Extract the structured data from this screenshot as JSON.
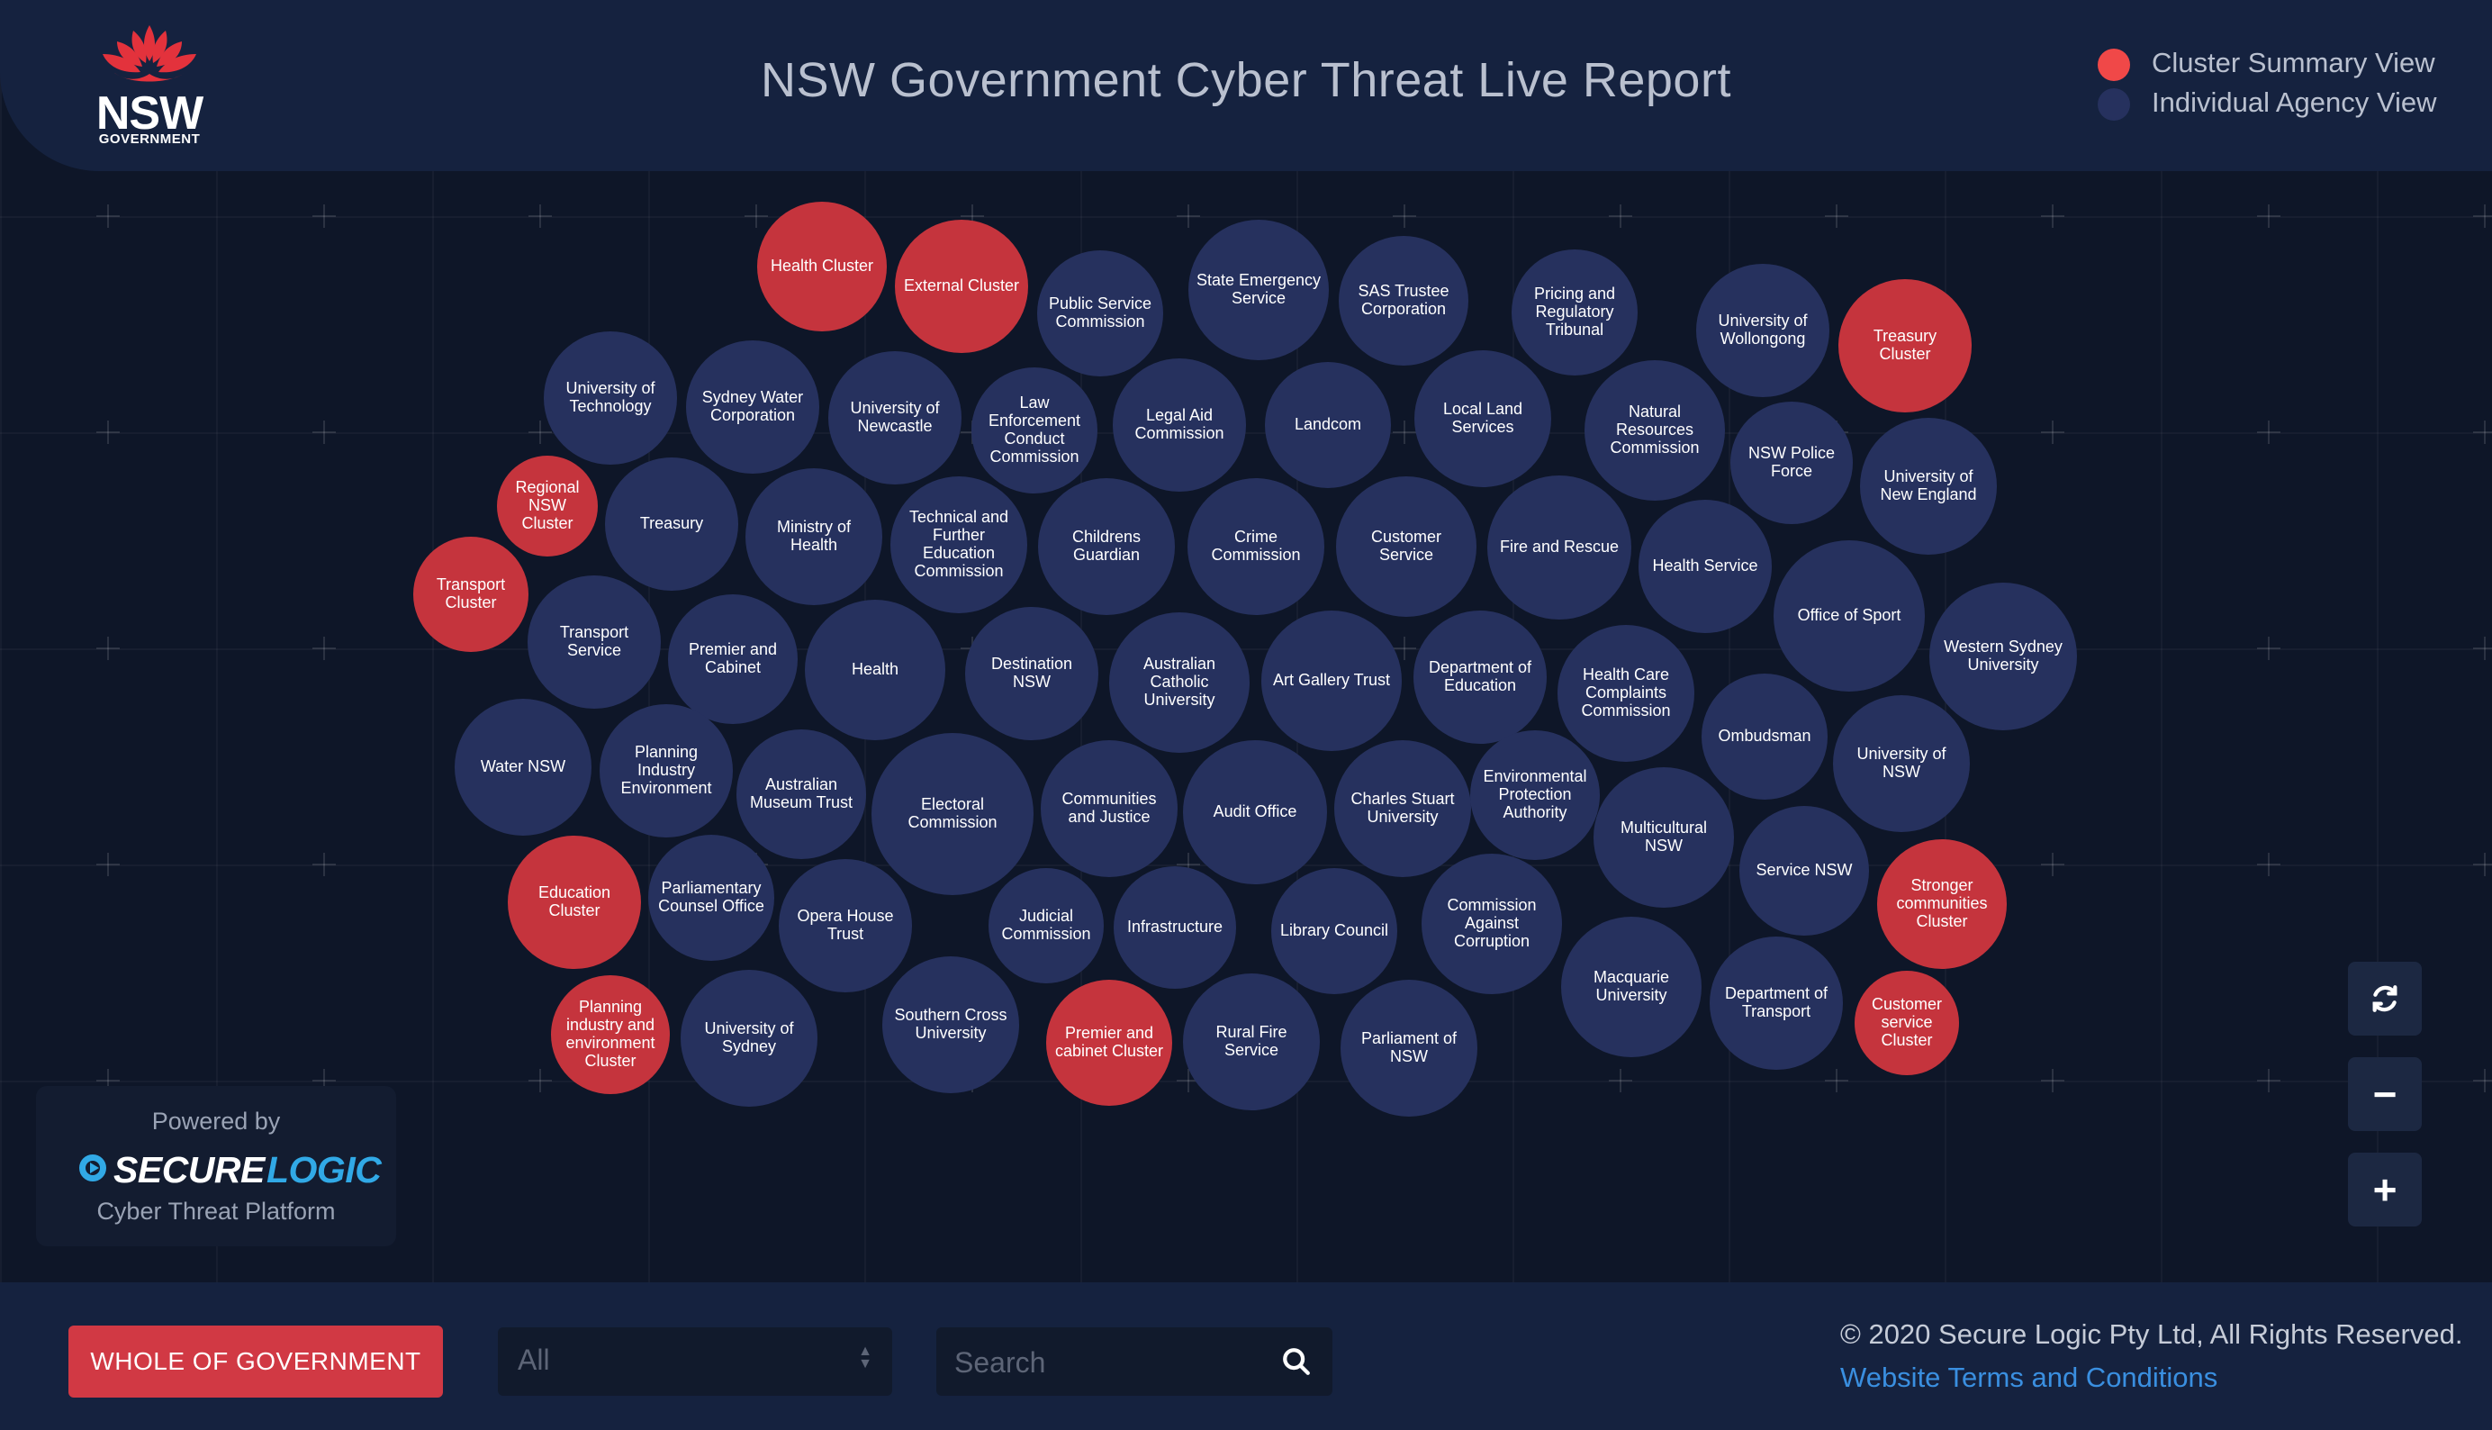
{
  "header": {
    "title": "NSW Government Cyber Threat Live Report",
    "logo_text": "NSW",
    "logo_subtext": "GOVERNMENT"
  },
  "legend": [
    {
      "label": "Cluster Summary View",
      "color": "#f04848"
    },
    {
      "label": "Individual Agency View",
      "color": "#26315e"
    }
  ],
  "colors": {
    "cluster": "#c5343d",
    "agency": "#26315e",
    "header_bg": "#15223f",
    "canvas_bg": "#0e1628",
    "accent_blue": "#31a9e6",
    "link": "#3a8fe0"
  },
  "bubbles": [
    {
      "label": "Health Cluster",
      "type": "cluster"
    },
    {
      "label": "External Cluster",
      "type": "cluster"
    },
    {
      "label": "Public Service Commission",
      "type": "agency"
    },
    {
      "label": "State Emergency Service",
      "type": "agency"
    },
    {
      "label": "SAS Trustee Corporation",
      "type": "agency"
    },
    {
      "label": "Pricing and Regulatory Tribunal",
      "type": "agency"
    },
    {
      "label": "University of Wollongong",
      "type": "agency"
    },
    {
      "label": "Treasury Cluster",
      "type": "cluster"
    },
    {
      "label": "University of Technology",
      "type": "agency"
    },
    {
      "label": "Sydney Water Corporation",
      "type": "agency"
    },
    {
      "label": "University of Newcastle",
      "type": "agency"
    },
    {
      "label": "Law Enforcement Conduct Commission",
      "type": "agency"
    },
    {
      "label": "Legal Aid Commission",
      "type": "agency"
    },
    {
      "label": "Landcom",
      "type": "agency"
    },
    {
      "label": "Local Land Services",
      "type": "agency"
    },
    {
      "label": "Natural Resources Commission",
      "type": "agency"
    },
    {
      "label": "NSW Police Force",
      "type": "agency"
    },
    {
      "label": "University of New England",
      "type": "agency"
    },
    {
      "label": "Regional NSW Cluster",
      "type": "cluster"
    },
    {
      "label": "Treasury",
      "type": "agency"
    },
    {
      "label": "Ministry of Health",
      "type": "agency"
    },
    {
      "label": "Technical and Further Education Commission",
      "type": "agency"
    },
    {
      "label": "Childrens Guardian",
      "type": "agency"
    },
    {
      "label": "Crime Commission",
      "type": "agency"
    },
    {
      "label": "Customer Service",
      "type": "agency"
    },
    {
      "label": "Fire and Rescue",
      "type": "agency"
    },
    {
      "label": "Health Service",
      "type": "agency"
    },
    {
      "label": "Office of Sport",
      "type": "agency"
    },
    {
      "label": "Western Sydney University",
      "type": "agency"
    },
    {
      "label": "Transport Cluster",
      "type": "cluster"
    },
    {
      "label": "Transport Service",
      "type": "agency"
    },
    {
      "label": "Premier and Cabinet",
      "type": "agency"
    },
    {
      "label": "Health",
      "type": "agency"
    },
    {
      "label": "Destination NSW",
      "type": "agency"
    },
    {
      "label": "Australian Catholic University",
      "type": "agency"
    },
    {
      "label": "Art Gallery Trust",
      "type": "agency"
    },
    {
      "label": "Department of Education",
      "type": "agency"
    },
    {
      "label": "Health Care Complaints Commission",
      "type": "agency"
    },
    {
      "label": "Ombudsman",
      "type": "agency"
    },
    {
      "label": "University of NSW",
      "type": "agency"
    },
    {
      "label": "Water NSW",
      "type": "agency"
    },
    {
      "label": "Planning Industry Environment",
      "type": "agency"
    },
    {
      "label": "Australian Museum Trust",
      "type": "agency"
    },
    {
      "label": "Electoral Commission",
      "type": "agency"
    },
    {
      "label": "Communities and Justice",
      "type": "agency"
    },
    {
      "label": "Audit Office",
      "type": "agency"
    },
    {
      "label": "Charles Stuart University",
      "type": "agency"
    },
    {
      "label": "Environmental Protection Authority",
      "type": "agency"
    },
    {
      "label": "Multicultural NSW",
      "type": "agency"
    },
    {
      "label": "Service NSW",
      "type": "agency"
    },
    {
      "label": "Stronger communities Cluster",
      "type": "cluster"
    },
    {
      "label": "Education Cluster",
      "type": "cluster"
    },
    {
      "label": "Parliamentary Counsel Office",
      "type": "agency"
    },
    {
      "label": "Opera House Trust",
      "type": "agency"
    },
    {
      "label": "Judicial Commission",
      "type": "agency"
    },
    {
      "label": "Infrastructure",
      "type": "agency"
    },
    {
      "label": "Library Council",
      "type": "agency"
    },
    {
      "label": "Commission Against Corruption",
      "type": "agency"
    },
    {
      "label": "Macquarie University",
      "type": "agency"
    },
    {
      "label": "Department of Transport",
      "type": "agency"
    },
    {
      "label": "Customer service Cluster",
      "type": "cluster"
    },
    {
      "label": "Planning industry and environment Cluster",
      "type": "cluster"
    },
    {
      "label": "University of Sydney",
      "type": "agency"
    },
    {
      "label": "Southern Cross University",
      "type": "agency"
    },
    {
      "label": "Premier and cabinet Cluster",
      "type": "cluster"
    },
    {
      "label": "Rural Fire Service",
      "type": "agency"
    },
    {
      "label": "Parliament of NSW",
      "type": "agency"
    }
  ],
  "powered": {
    "by": "Powered by",
    "brand_secure": "SECURE",
    "brand_logic": "LOGIC",
    "platform": "Cyber Threat Platform"
  },
  "controls": {
    "refresh_icon": "refresh-icon",
    "zoom_out_glyph": "−",
    "zoom_in_glyph": "+"
  },
  "footer": {
    "wog_label": "WHOLE OF GOVERNMENT",
    "select_value": "All",
    "search_placeholder": "Search",
    "copyright": "© 2020 Secure Logic Pty Ltd, All Rights Reserved.",
    "terms": "Website Terms and Conditions"
  }
}
